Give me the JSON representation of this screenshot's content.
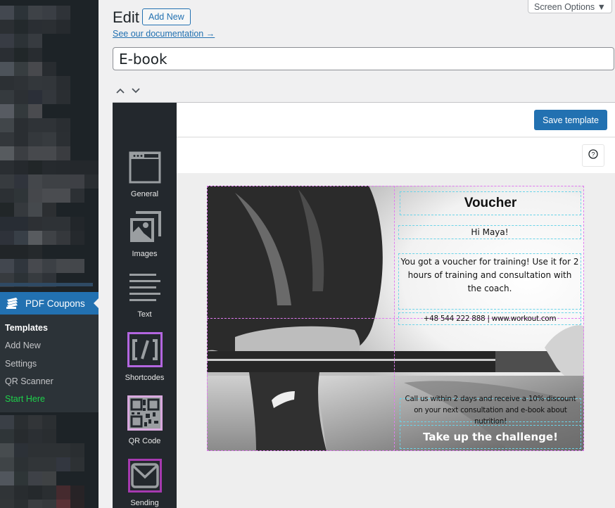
{
  "sidebar": {
    "menu_title": "PDF Coupons",
    "menu_icon": "coupons-icon",
    "submenu": [
      {
        "label": "Templates",
        "current": true
      },
      {
        "label": "Add New"
      },
      {
        "label": "Settings"
      },
      {
        "label": "QR Scanner"
      },
      {
        "label": "Start Here",
        "highlight": true
      }
    ],
    "highlight_color": "#1ed14b"
  },
  "header": {
    "screen_options": "Screen Options ▼",
    "title": "Edit",
    "add_new": "Add New",
    "doc_link": "See our documentation →",
    "template_name": "E-book"
  },
  "editor": {
    "save_label": "Save template",
    "help_icon": "?",
    "tools": [
      {
        "label": "General",
        "icon": "window-icon"
      },
      {
        "label": "Images",
        "icon": "images-icon"
      },
      {
        "label": "Text",
        "icon": "text-icon"
      },
      {
        "label": "Shortcodes",
        "icon": "shortcode-icon"
      },
      {
        "label": "QR Code",
        "icon": "qr-code-icon"
      },
      {
        "label": "Sending",
        "icon": "envelope-icon"
      }
    ]
  },
  "voucher": {
    "title": "Voucher",
    "greeting": "Hi Maya!",
    "body": "You got a voucher for training! Use it for 2 hours of training and consultation with the coach.",
    "contact": "+48 544 222 888 | www.workout.com",
    "offer": "Call us within 2 days and receive a 10% discount on your next consultation and e-book about nutrition!",
    "cta": "Take up the challenge!"
  },
  "colors": {
    "accent": "#2271b1",
    "sidebar_bg": "#1d2327",
    "guide_outer": "#e07bf0",
    "guide_inner": "#6cd3e8"
  }
}
